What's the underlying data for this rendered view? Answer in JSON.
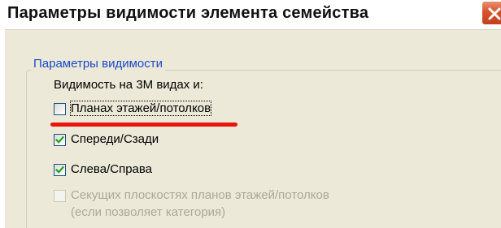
{
  "window": {
    "title": "Параметры видимости элемента семейства"
  },
  "group": {
    "legend": "Параметры видимости",
    "prompt": "Видимость на 3М видах и:",
    "options": [
      {
        "label": "Планах этажей/потолков",
        "checked": false,
        "enabled": true,
        "focused": true
      },
      {
        "label": "Спереди/Сзади",
        "checked": true,
        "enabled": true
      },
      {
        "label": "Слева/Справа",
        "checked": true,
        "enabled": true
      },
      {
        "label_line1": "Секущих плоскостях планов этажей/потолков",
        "label_line2": "(если позволяет категория)",
        "checked": false,
        "enabled": false
      }
    ]
  },
  "colors": {
    "dialog_bg": "#ece9d8",
    "legend": "#1a49c9",
    "check_mark": "#21a121",
    "annotation_underline": "#e8140d",
    "disabled_text": "#aca899"
  },
  "icons": {
    "close": "close-icon",
    "check": "check-mark-icon"
  }
}
